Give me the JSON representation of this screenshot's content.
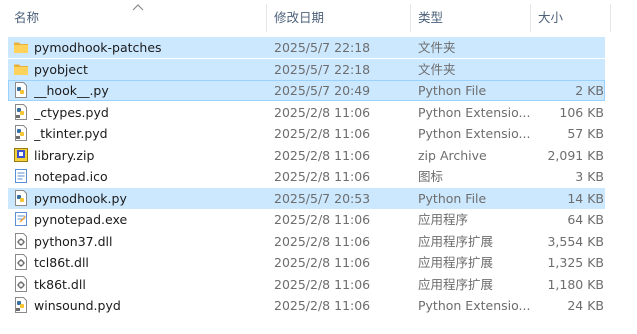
{
  "columns": {
    "name": "名称",
    "date": "修改日期",
    "type": "类型",
    "size": "大小"
  },
  "colors": {
    "selected": "#cce8ff",
    "header_text": "#4c607a",
    "secondary_text": "#6d6d6d"
  },
  "rows": [
    {
      "icon": "folder-icon",
      "name": "pymodhook-patches",
      "date": "2025/5/7 22:18",
      "type": "文件夹",
      "size": "",
      "state": "selected"
    },
    {
      "icon": "folder-icon",
      "name": "pyobject",
      "date": "2025/5/7 22:18",
      "type": "文件夹",
      "size": "",
      "state": "selected"
    },
    {
      "icon": "python-file-icon",
      "name": "__hook__.py",
      "date": "2025/5/7 20:49",
      "type": "Python File",
      "size": "2 KB",
      "state": "focused"
    },
    {
      "icon": "python-extension-icon",
      "name": "_ctypes.pyd",
      "date": "2025/2/8 11:06",
      "type": "Python Extensio...",
      "size": "106 KB",
      "state": ""
    },
    {
      "icon": "python-extension-icon",
      "name": "_tkinter.pyd",
      "date": "2025/2/8 11:06",
      "type": "Python Extensio...",
      "size": "57 KB",
      "state": ""
    },
    {
      "icon": "zip-archive-icon",
      "name": "library.zip",
      "date": "2025/2/8 11:06",
      "type": "zip Archive",
      "size": "2,091 KB",
      "state": ""
    },
    {
      "icon": "notepad-ico-icon",
      "name": "notepad.ico",
      "date": "2025/2/8 11:06",
      "type": "图标",
      "size": "3 KB",
      "state": ""
    },
    {
      "icon": "python-file-icon",
      "name": "pymodhook.py",
      "date": "2025/5/7 20:53",
      "type": "Python File",
      "size": "14 KB",
      "state": "selected"
    },
    {
      "icon": "notepad-exe-icon",
      "name": "pynotepad.exe",
      "date": "2025/2/8 11:06",
      "type": "应用程序",
      "size": "64 KB",
      "state": ""
    },
    {
      "icon": "dll-file-icon",
      "name": "python37.dll",
      "date": "2025/2/8 11:06",
      "type": "应用程序扩展",
      "size": "3,554 KB",
      "state": ""
    },
    {
      "icon": "dll-file-icon",
      "name": "tcl86t.dll",
      "date": "2025/2/8 11:06",
      "type": "应用程序扩展",
      "size": "1,325 KB",
      "state": ""
    },
    {
      "icon": "dll-file-icon",
      "name": "tk86t.dll",
      "date": "2025/2/8 11:06",
      "type": "应用程序扩展",
      "size": "1,180 KB",
      "state": ""
    },
    {
      "icon": "python-extension-icon",
      "name": "winsound.pyd",
      "date": "2025/2/8 11:06",
      "type": "Python Extensio...",
      "size": "24 KB",
      "state": ""
    }
  ]
}
